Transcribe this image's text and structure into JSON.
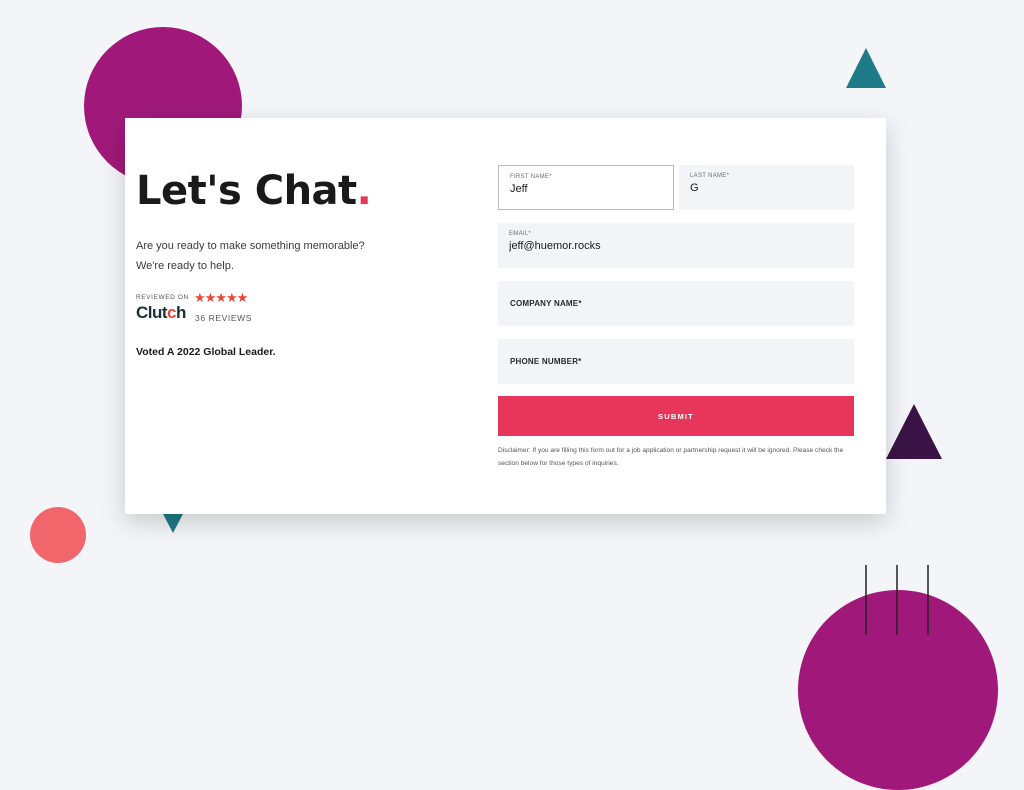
{
  "hero": {
    "title": "Let's Chat",
    "title_dot": ".",
    "intro_line1": "Are you ready to make something memorable?",
    "intro_line2": "We're ready to help."
  },
  "clutch": {
    "reviewed_on": "REVIEWED ON",
    "logo_start": "Clut",
    "logo_accent": "c",
    "logo_end": "h",
    "stars": "★★★★★",
    "rating_stars": 5,
    "reviews": "36 REVIEWS"
  },
  "voted": "Voted A 2022 Global Leader.",
  "form": {
    "first_name": {
      "label": "FIRST NAME*",
      "value": "Jeff"
    },
    "last_name": {
      "label": "LAST NAME*",
      "value": "G"
    },
    "email": {
      "label": "EMAIL*",
      "value": "jeff@huemor.rocks"
    },
    "company": {
      "label": "COMPANY NAME*"
    },
    "phone": {
      "label": "PHONE NUMBER*"
    },
    "submit_label": "SUBMIT",
    "disclaimer": "Disclaimer: If you are filling this form out for a job application or partnership request it will be ignored. Please check the section below for those types of inquiries."
  },
  "colors": {
    "accent": "#e8365a",
    "purple": "#a0197a",
    "teal": "#1e7a87",
    "dark_purple": "#3a1446",
    "coral": "#f0666a"
  }
}
